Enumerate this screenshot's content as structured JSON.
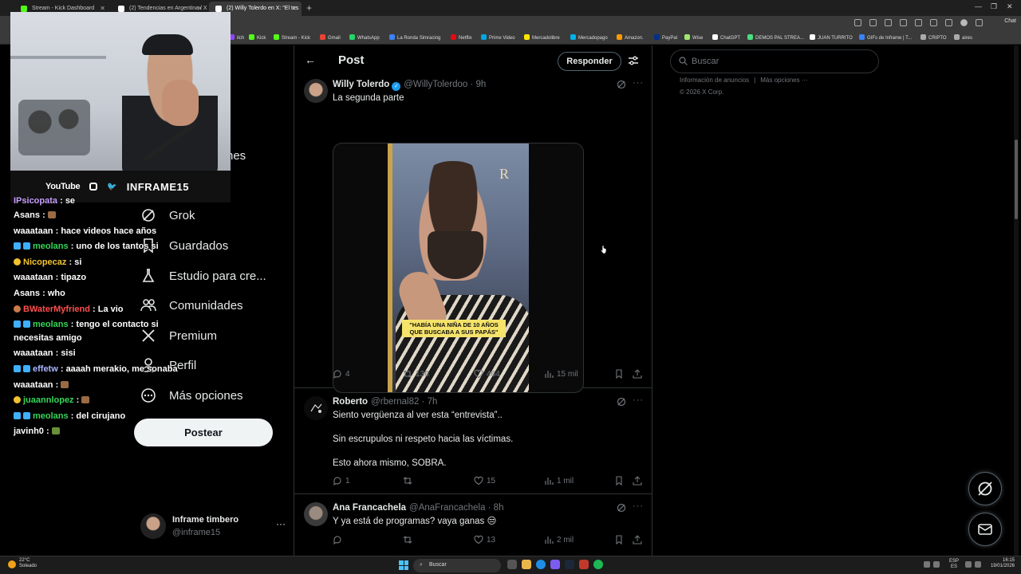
{
  "browser": {
    "tabs": [
      {
        "label": "Stream - Kick Dashboard",
        "active": false,
        "favicon_color": "#53fc18"
      },
      {
        "label": "(2) Tendencias en Argentina / X",
        "active": false,
        "favicon_color": "#ffffff"
      },
      {
        "label": "(2) Willy Tolerdo en X: \"El tes",
        "active": true,
        "favicon_color": "#ffffff"
      }
    ],
    "new_tab": "+",
    "chat_label": "Chat",
    "bookmarks": [
      {
        "label": "itch",
        "color": "#9146ff"
      },
      {
        "label": "Kick",
        "color": "#53fc18"
      },
      {
        "label": "Stream - Kick",
        "color": "#53fc18"
      },
      {
        "label": "Gmail",
        "color": "#ea4335"
      },
      {
        "label": "WhatsApp",
        "color": "#25d366"
      },
      {
        "label": "La Ronda Simracing",
        "color": "#3b82f6"
      },
      {
        "label": "Netflix",
        "color": "#e50914"
      },
      {
        "label": "Prime Video",
        "color": "#00a8e1"
      },
      {
        "label": "Mercadolibre",
        "color": "#ffe600"
      },
      {
        "label": "Mercadopago",
        "color": "#00b1ea"
      },
      {
        "label": "Amazon.",
        "color": "#ff9900"
      },
      {
        "label": "PayPal",
        "color": "#003087"
      },
      {
        "label": "Wise",
        "color": "#9fe870"
      },
      {
        "label": "ChatGPT",
        "color": "#ffffff"
      },
      {
        "label": "DEMOS PAL STREA...",
        "color": "#4ade80"
      },
      {
        "label": "JUAN TURRITO",
        "color": "#ffffff"
      },
      {
        "label": "GIFs de Inframe | T...",
        "color": "#3b82f6"
      },
      {
        "label": "CRIPTO",
        "color": "#aaaaaa"
      },
      {
        "label": "aires",
        "color": "#aaaaaa"
      }
    ]
  },
  "overlay": {
    "youtube_label": "YouTube",
    "handle": "INFRAME15",
    "twitter_glyph": "🐦",
    "chat": [
      {
        "user": "IPsicopata",
        "msg": "se",
        "color": "purple",
        "badge": "none",
        "cut": true
      },
      {
        "user": "Asans",
        "msg": "",
        "color": "white",
        "badge": "none",
        "emote": "brown"
      },
      {
        "user": "waaataan",
        "msg": "hace videos hace años",
        "color": "white",
        "badge": "none"
      },
      {
        "user": "meolans",
        "msg": "uno de los tantos si",
        "color": "green",
        "badge": "blue"
      },
      {
        "user": "Nicopecaz",
        "msg": "si",
        "color": "yellow",
        "badge": "crown"
      },
      {
        "user": "waaataan",
        "msg": "tipazo",
        "color": "white",
        "badge": "none"
      },
      {
        "user": "Asans",
        "msg": "who",
        "color": "white",
        "badge": "none"
      },
      {
        "user": "BWaterMyfriend",
        "msg": "La vio",
        "color": "red",
        "badge": "drop"
      },
      {
        "user": "meolans",
        "msg": "tengo el contacto si",
        "color": "green",
        "badge": "blue"
      },
      {
        "user": "",
        "msg": "necesitas amigo",
        "color": "white",
        "badge": "none",
        "continuation": true
      },
      {
        "user": "waaataan",
        "msg": "sisi",
        "color": "white",
        "badge": "none"
      },
      {
        "user": "effetw",
        "msg": "aaaah merakio, me sonaba",
        "color": "blue",
        "badge": "blue"
      },
      {
        "user": "waaataan",
        "msg": "",
        "color": "white",
        "badge": "none",
        "emote": "brown"
      },
      {
        "user": "juaannlopez",
        "msg": "",
        "color": "green",
        "badge": "yellow",
        "emote": "brown"
      },
      {
        "user": "meolans",
        "msg": "del cirujano",
        "color": "green",
        "badge": "blue"
      },
      {
        "user": "javinh0",
        "msg": "",
        "color": "white",
        "badge": "none",
        "emote": "green"
      }
    ]
  },
  "xnav": {
    "partial_item": "nes",
    "items": [
      {
        "label": "Grok",
        "icon": "grok-icon"
      },
      {
        "label": "Guardados",
        "icon": "bookmark-icon"
      },
      {
        "label": "Estudio para cre...",
        "icon": "flask-icon"
      },
      {
        "label": "Comunidades",
        "icon": "people-icon"
      },
      {
        "label": "Premium",
        "icon": "x-logo-icon"
      },
      {
        "label": "Perfil",
        "icon": "person-icon"
      },
      {
        "label": "Más opciones",
        "icon": "more-circle-icon"
      }
    ],
    "post_button": "Postear",
    "account": {
      "name": "Inframe timbero",
      "handle": "@inframe15",
      "more": "···"
    }
  },
  "main": {
    "title": "Post",
    "back_glyph": "←",
    "reply_button": "Responder",
    "tweets": [
      {
        "name": "Willy Tolerdo",
        "verified": true,
        "handle": "@WillyTolerdoo · 9h",
        "text": [
          "La segunda parte"
        ],
        "media_caption": "\"HABÍA UNA NIÑA DE 10 AÑOS QUE BUSCABA A SUS PAPÁS\"",
        "media_logo": "R",
        "replies": "4",
        "reposts": "136",
        "likes": "464",
        "views": "15 mil"
      },
      {
        "name": "Roberto",
        "verified": false,
        "handle": "@rbernal82 · 7h",
        "text": [
          "Siento vergüenza al ver esta “entrevista”..",
          "",
          "Sin escrupulos ni respeto hacia las víctimas.",
          "",
          "Esto ahora mismo, SOBRA."
        ],
        "replies": "1",
        "reposts": "",
        "likes": "15",
        "views": "1 mil"
      },
      {
        "name": "Ana Francachela",
        "verified": false,
        "handle": "@AnaFrancachela · 8h",
        "text": [
          "Y ya está de programas? vaya ganas 😒"
        ],
        "replies": "",
        "reposts": "",
        "likes": "13",
        "views": "2 mil"
      }
    ]
  },
  "right": {
    "search_placeholder": "Buscar",
    "footer_links": [
      "Información de anuncios",
      "|",
      "Más opciones ···"
    ],
    "copyright": "© 2026 X Corp."
  },
  "taskbar": {
    "temp": "22°C",
    "weather": "Soleado",
    "search": "Buscar",
    "lang_top": "ESP",
    "lang_bottom": "ES",
    "time": "16:15",
    "date": "19/01/2026"
  },
  "colors": {
    "accent": "#1d9bf0",
    "kick_green": "#53fc18",
    "background": "#000000"
  }
}
